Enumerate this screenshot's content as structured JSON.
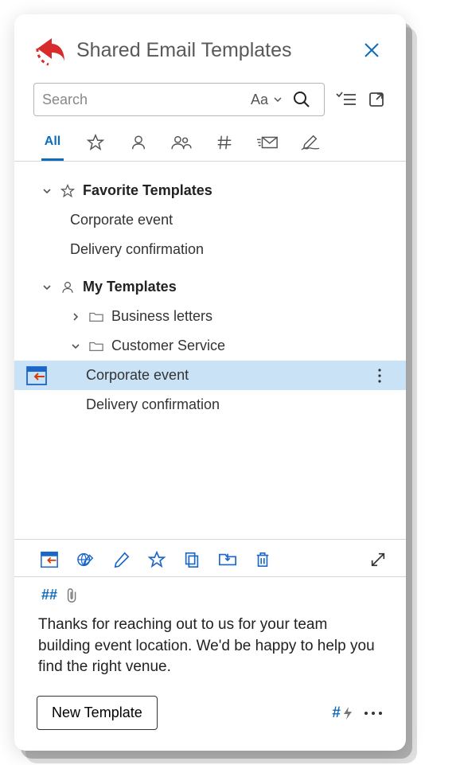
{
  "header": {
    "title": "Shared Email Templates"
  },
  "search": {
    "placeholder": "Search",
    "case_label": "Aa"
  },
  "tabs": {
    "all_label": "All"
  },
  "tree": {
    "favorites": {
      "title": "Favorite Templates",
      "items": [
        {
          "label": "Corporate event"
        },
        {
          "label": "Delivery confirmation"
        }
      ]
    },
    "my": {
      "title": "My Templates",
      "folders": [
        {
          "label": "Business letters",
          "expanded": false
        },
        {
          "label": "Customer Service",
          "expanded": true,
          "items": [
            {
              "label": "Corporate event",
              "selected": true
            },
            {
              "label": "Delivery confirmation",
              "selected": false
            }
          ]
        }
      ]
    }
  },
  "meta": {
    "hashmark": "##"
  },
  "preview": {
    "text": "Thanks for reaching out to us for your team building event location. We'd be happy to help you find the right venue."
  },
  "footer": {
    "new_template_label": "New Template",
    "tag_symbol": "#"
  },
  "icons": {
    "close": "close-icon",
    "logo": "reply-logo-icon",
    "search": "search-icon",
    "case": "case-toggle-icon",
    "checklist": "checklist-icon",
    "popout": "popout-icon",
    "star": "star-icon",
    "person": "person-icon",
    "people": "people-icon",
    "hash": "hash-icon",
    "mail": "mail-icon",
    "signature": "signature-icon",
    "folder": "folder-icon",
    "insert": "insert-icon",
    "globe": "globe-edit-icon",
    "pencil": "pencil-icon",
    "copy": "copy-icon",
    "move": "move-to-folder-icon",
    "trash": "trash-icon",
    "expand": "expand-icon",
    "attach": "paperclip-icon",
    "bolt": "bolt-icon",
    "more": "more-icon"
  }
}
